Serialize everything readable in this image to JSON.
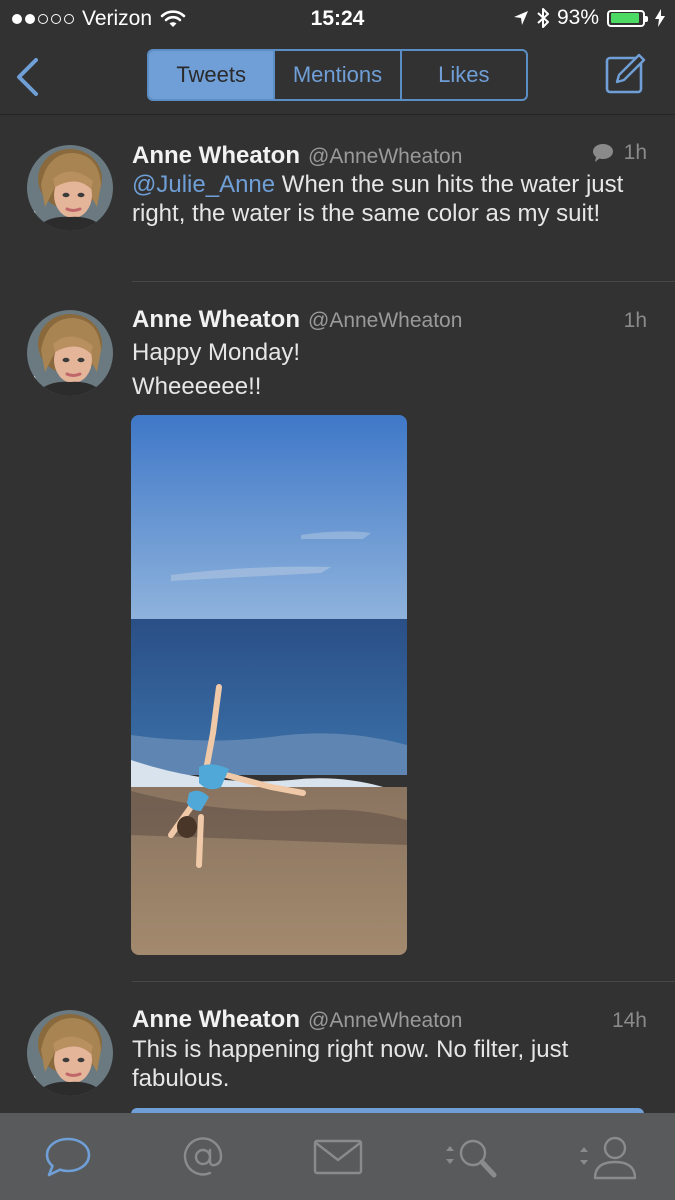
{
  "status_bar": {
    "carrier": "Verizon",
    "time": "15:24",
    "battery": "93%",
    "battery_level": 0.93,
    "battery_color": "#4cd964"
  },
  "nav": {
    "back_icon": "chevron-left-icon",
    "tabs": [
      {
        "label": "Tweets",
        "active": true
      },
      {
        "label": "Mentions",
        "active": false
      },
      {
        "label": "Likes",
        "active": false
      }
    ],
    "compose_icon": "compose-icon"
  },
  "tweets": [
    {
      "name": "Anne Wheaton",
      "handle": "@AnneWheaton",
      "time": "1h",
      "has_reply_icon": true,
      "mention": "@Julie_Anne",
      "text": " When the sun hits the water just right, the water is the same color as my suit!"
    },
    {
      "name": "Anne Wheaton",
      "handle": "@AnneWheaton",
      "time": "1h",
      "line1": "Happy Monday!",
      "line2": "Wheeeeee!!",
      "media_icon": "beach-cartwheel-photo"
    },
    {
      "name": "Anne Wheaton",
      "handle": "@AnneWheaton",
      "time": "14h",
      "text": "This is happening right now. No filter, just fabulous."
    }
  ],
  "tab_bar": {
    "items": [
      {
        "icon": "timeline-bubble-icon",
        "active": true
      },
      {
        "icon": "at-sign-icon",
        "active": false
      },
      {
        "icon": "envelope-icon",
        "active": false
      },
      {
        "icon": "search-icon",
        "active": false
      },
      {
        "icon": "profile-icon",
        "active": false
      }
    ],
    "accent": "#6f9fd6"
  },
  "colors": {
    "background": "#323233",
    "accent": "#6f9fd6",
    "tab_bar": "#595a5c"
  }
}
